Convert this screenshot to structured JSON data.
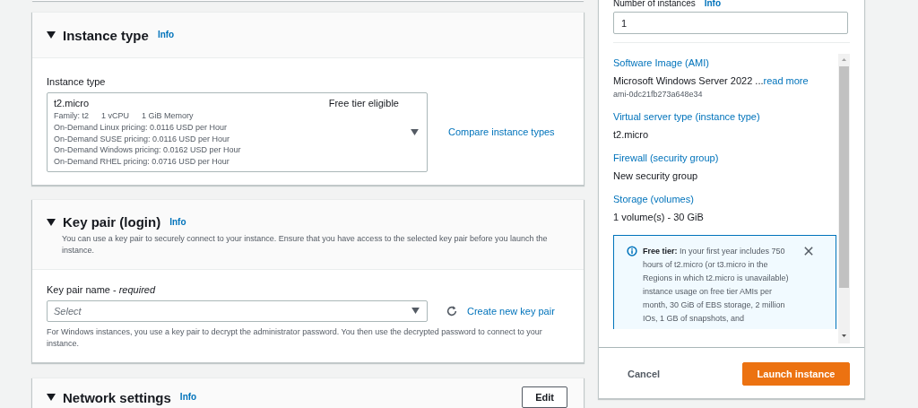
{
  "instance_type": {
    "title": "Instance type",
    "info": "Info",
    "field_label": "Instance type",
    "select": {
      "name": "t2.micro",
      "badge": "Free tier eligible",
      "specs": [
        "Family: t2",
        "1 vCPU",
        "1 GiB Memory"
      ],
      "pricing": [
        "On-Demand Linux pricing: 0.0116 USD per Hour",
        "On-Demand SUSE pricing: 0.0116 USD per Hour",
        "On-Demand Windows pricing: 0.0162 USD per Hour",
        "On-Demand RHEL pricing: 0.0716 USD per Hour"
      ]
    },
    "compare_link": "Compare instance types"
  },
  "key_pair": {
    "title": "Key pair (login)",
    "info": "Info",
    "description": "You can use a key pair to securely connect to your instance. Ensure that you have access to the selected key pair before you launch the instance.",
    "field_label": "Key pair name - *required*",
    "placeholder": "Select",
    "create_link": "Create new key pair",
    "helper": "For Windows instances, you use a key pair to decrypt the administrator password. You then use the decrypted password to connect to your instance."
  },
  "network": {
    "title": "Network settings",
    "info": "Info",
    "edit_button": "Edit"
  },
  "summary": {
    "instances_label": "Number of instances",
    "info": "Info",
    "instances_value": "1",
    "sections": [
      {
        "label": "Software Image (AMI)",
        "value": "Microsoft Windows Server 2022 ...",
        "link": "read more",
        "sub": "ami-0dc21fb273a648e34"
      },
      {
        "label": "Virtual server type (instance type)",
        "value": "t2.micro"
      },
      {
        "label": "Firewall (security group)",
        "value": "New security group"
      },
      {
        "label": "Storage (volumes)",
        "value": "1 volume(s) - 30 GiB"
      }
    ],
    "alert": {
      "text": "**Free tier:** In your first year includes 750 hours of t2.micro (or t3.micro in the Regions in which t2.micro is unavailable) instance usage on free tier AMIs per month, 30 GiB of EBS storage, 2 million IOs, 1 GB of snapshots, and"
    },
    "cancel": "Cancel",
    "launch": "Launch instance"
  }
}
